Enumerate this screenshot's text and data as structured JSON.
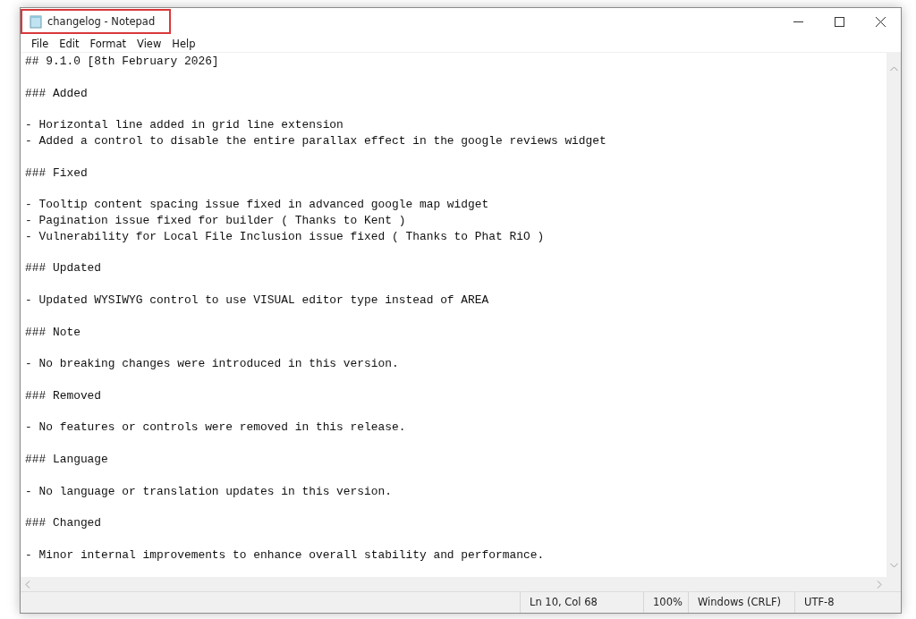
{
  "window": {
    "title": "changelog - Notepad",
    "title_highlighted": true
  },
  "menu": [
    "File",
    "Edit",
    "Format",
    "View",
    "Help"
  ],
  "document": {
    "header": "## 9.1.0 [8th February 2026]",
    "sections": [
      {
        "heading": "### Added",
        "items": [
          "- Horizontal line added in grid line extension",
          "- Added a control to disable the entire parallax effect in the google reviews widget"
        ]
      },
      {
        "heading": "### Fixed",
        "items": [
          "- Tooltip content spacing issue fixed in advanced google map widget",
          "- Pagination issue fixed for builder ( Thanks to Kent )",
          "- Vulnerability for Local File Inclusion issue fixed ( Thanks to Phat RiO )"
        ]
      },
      {
        "heading": "### Updated",
        "items": [
          "- Updated WYSIWYG control to use VISUAL editor type instead of AREA"
        ]
      },
      {
        "heading": "### Note",
        "items": [
          "- No breaking changes were introduced in this version."
        ]
      },
      {
        "heading": "### Removed",
        "items": [
          "- No features or controls were removed in this release."
        ]
      },
      {
        "heading": "### Language",
        "items": [
          "- No language or translation updates in this version."
        ]
      },
      {
        "heading": "### Changed",
        "items": [
          "- Minor internal improvements to enhance overall stability and performance."
        ]
      }
    ]
  },
  "status_bar": [
    "Ln 10, Col 68",
    "100%",
    "Windows (CRLF)",
    "UTF-8"
  ]
}
